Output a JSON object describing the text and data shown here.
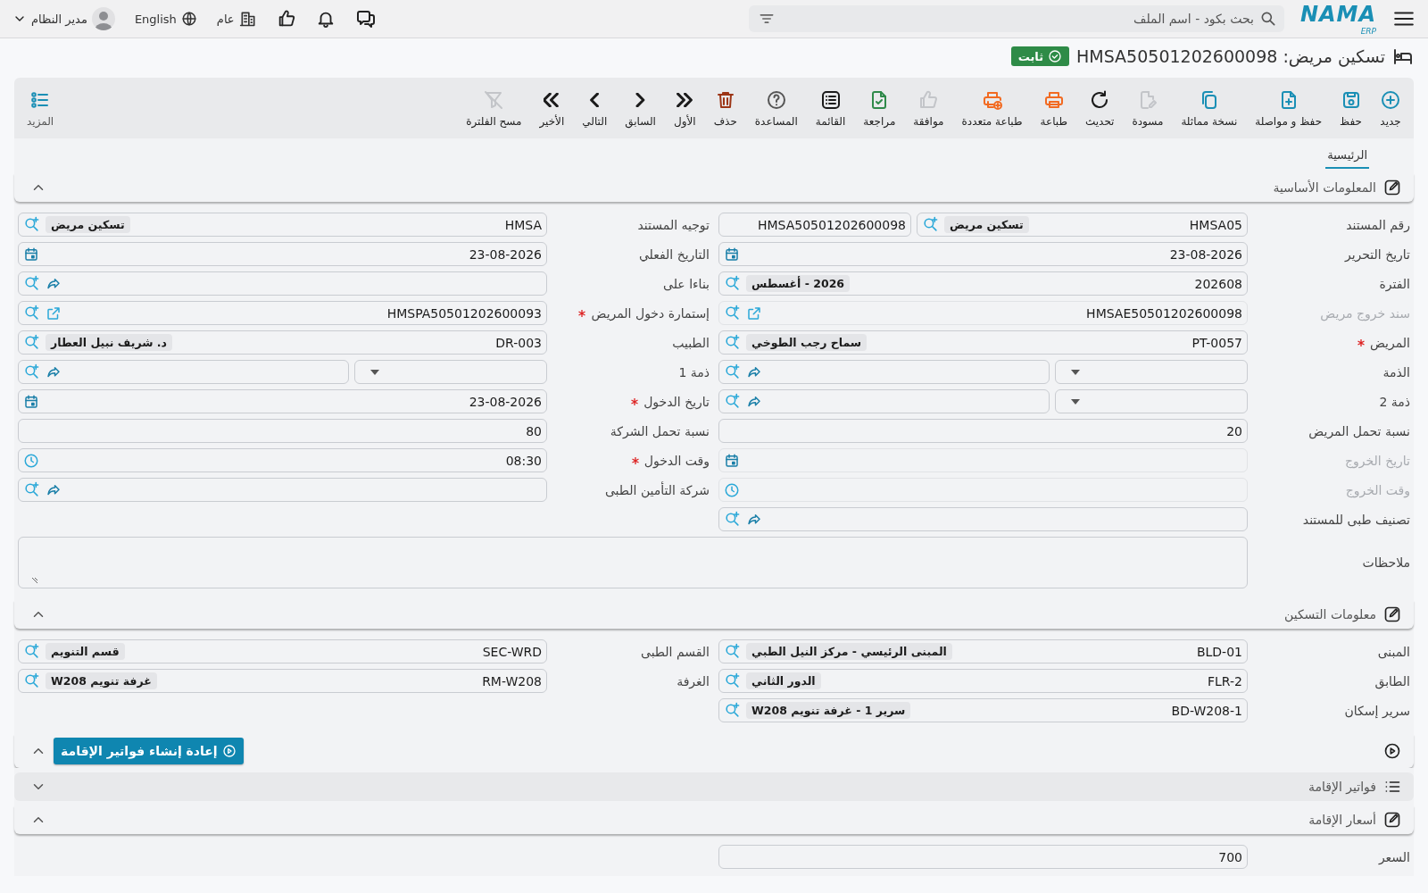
{
  "topbar": {
    "logo": {
      "name": "NAMA",
      "sub": "ERP"
    },
    "search": {
      "placeholder": "بحث بكود - اسم الملف"
    },
    "branch": "عام",
    "language": "English",
    "user": "مدير النظام"
  },
  "title": {
    "text": "تسكين مريض: HMSA50501202600098",
    "status": "ثابت"
  },
  "toolbar": {
    "items": [
      {
        "kind": "new",
        "label": "جديد",
        "color": "#1a8fb5",
        "disabled": false
      },
      {
        "kind": "save",
        "label": "حفظ",
        "color": "#1a8fb5",
        "disabled": false
      },
      {
        "kind": "save-continue",
        "label": "حفظ و مواصلة",
        "color": "#1a8fb5",
        "disabled": false
      },
      {
        "kind": "copy",
        "label": "نسخة مماثلة",
        "color": "#1a8fb5",
        "disabled": false
      },
      {
        "kind": "draft",
        "label": "مسودة",
        "disabled": true
      },
      {
        "kind": "refresh",
        "label": "تحديث",
        "color": "#1b1b1b",
        "disabled": false
      },
      {
        "kind": "print",
        "label": "طباعة",
        "color": "#f26a21",
        "disabled": false
      },
      {
        "kind": "multi-print",
        "label": "طباعة متعددة",
        "color": "#f26a21",
        "disabled": false
      },
      {
        "kind": "approve",
        "label": "موافقة",
        "disabled": true
      },
      {
        "kind": "review",
        "label": "مراجعة",
        "color": "#2f8a4a",
        "disabled": false
      },
      {
        "kind": "list",
        "label": "القائمة",
        "color": "#1b1b1b",
        "disabled": false
      },
      {
        "kind": "help",
        "label": "المساعدة",
        "color": "#555555",
        "disabled": false
      },
      {
        "kind": "delete",
        "label": "حذف",
        "color": "#9c3516",
        "disabled": false
      },
      {
        "kind": "first",
        "label": "الأول",
        "color": "#1b1b1b",
        "disabled": false
      },
      {
        "kind": "previous",
        "label": "السابق",
        "color": "#1b1b1b",
        "disabled": false
      },
      {
        "kind": "next",
        "label": "التالي",
        "color": "#1b1b1b",
        "disabled": false
      },
      {
        "kind": "last",
        "label": "الأخير",
        "color": "#1b1b1b",
        "disabled": false
      },
      {
        "kind": "clear-filter",
        "label": "مسح الفلترة",
        "disabled": true
      },
      {
        "kind": "more",
        "label": "المزيد",
        "color": "#1a8fb5",
        "disabled": false
      }
    ]
  },
  "tabs": [
    {
      "label": "الرئيسية",
      "selected": true
    }
  ],
  "sections": [
    {
      "kind": "edit",
      "title": "المعلومات الأساسية",
      "expanded": true,
      "fields": [
        {
          "kind": "docno",
          "label": "رقم المستند",
          "value": "HMSA05",
          "chip": "تسكين مريض",
          "extra": "HMSA50501202600098",
          "required": false,
          "disabled": false
        },
        {
          "kind": "code",
          "label": "توجيه المستند",
          "value": "HMSA",
          "chip": "تسكين مريض",
          "required": false,
          "disabled": false
        },
        {
          "kind": "date",
          "label": "تاريخ التحرير",
          "value": "23-08-2026",
          "required": false,
          "disabled": false
        },
        {
          "kind": "date",
          "label": "التاريخ الفعلي",
          "value": "23-08-2026",
          "required": false,
          "disabled": false
        },
        {
          "kind": "code",
          "label": "الفترة",
          "value": "202608",
          "chip": "2026 - أغسطس",
          "required": false,
          "disabled": false
        },
        {
          "kind": "link",
          "label": "بناءا على",
          "required": false,
          "disabled": false
        },
        {
          "kind": "doc",
          "label": "سند خروج مريض",
          "value": "HMSAE50501202600098",
          "required": false,
          "disabled": true
        },
        {
          "kind": "doc",
          "label": "إستمارة دخول المريض",
          "value": "HMSPA50501202600093",
          "required": true,
          "disabled": false
        },
        {
          "kind": "code",
          "label": "المريض",
          "value": "PT-0057",
          "chip": "سماح رجب الطوخي",
          "required": true,
          "disabled": false
        },
        {
          "kind": "code",
          "label": "الطبيب",
          "value": "DR-003",
          "chip": "د. شريف نبيل العطار",
          "required": false,
          "disabled": false
        },
        {
          "kind": "pair",
          "label": "الذمة",
          "required": false,
          "disabled": false
        },
        {
          "kind": "pair",
          "label": "ذمة 1",
          "required": false,
          "disabled": false
        },
        {
          "kind": "pair",
          "label": "ذمة 2",
          "required": false,
          "disabled": false
        },
        {
          "kind": "date",
          "label": "تاريخ الدخول",
          "value": "23-08-2026",
          "required": true,
          "disabled": false
        },
        {
          "kind": "number",
          "label": "نسبة تحمل المريض",
          "value": "20",
          "required": false,
          "disabled": false
        },
        {
          "kind": "number",
          "label": "نسبة تحمل الشركة",
          "value": "80",
          "required": false,
          "disabled": false
        },
        {
          "kind": "date",
          "label": "تاريخ الخروج",
          "required": false,
          "disabled": true
        },
        {
          "kind": "time",
          "label": "وقت الدخول",
          "value": "08:30",
          "required": true,
          "disabled": false
        },
        {
          "kind": "time",
          "label": "وقت الخروج",
          "required": false,
          "disabled": true
        },
        {
          "kind": "link",
          "label": "شركة التأمين الطبى",
          "required": false,
          "disabled": false
        },
        {
          "kind": "link",
          "label": "تصنيف طبى للمستند",
          "required": false,
          "disabled": false
        },
        {
          "kind": "textarea",
          "label": "ملاحظات",
          "required": false,
          "disabled": false
        }
      ]
    },
    {
      "kind": "edit",
      "title": "معلومات التسكين",
      "expanded": true,
      "fields": [
        {
          "kind": "code",
          "label": "المبنى",
          "value": "BLD-01",
          "chip": "المبنى الرئيسي - مركز النيل الطبي",
          "required": false,
          "disabled": false
        },
        {
          "kind": "code",
          "label": "القسم الطبى",
          "value": "SEC-WRD",
          "chip": "قسم التنويم",
          "required": false,
          "disabled": false
        },
        {
          "kind": "code",
          "label": "الطابق",
          "value": "FLR-2",
          "chip": "الدور الثاني",
          "required": false,
          "disabled": false
        },
        {
          "kind": "code",
          "label": "الغرفة",
          "value": "RM-W208",
          "chip": "غرفة تنويم W208",
          "required": false,
          "disabled": false
        },
        {
          "kind": "code",
          "label": "سرير إسكان",
          "value": "BD-W208-1",
          "chip": "سرير 1 - غرفة تنويم W208",
          "required": false,
          "disabled": false
        }
      ]
    },
    {
      "kind": "action",
      "expanded": true,
      "button": "إعادة إنشاء فواتير الإقامة"
    },
    {
      "kind": "list",
      "title": "فواتير الإقامة",
      "expanded": false
    },
    {
      "kind": "edit",
      "title": "أسعار الإقامة",
      "expanded": true,
      "fields": [
        {
          "kind": "number",
          "label": "السعر",
          "value": "700",
          "required": false,
          "disabled": false
        }
      ]
    }
  ]
}
